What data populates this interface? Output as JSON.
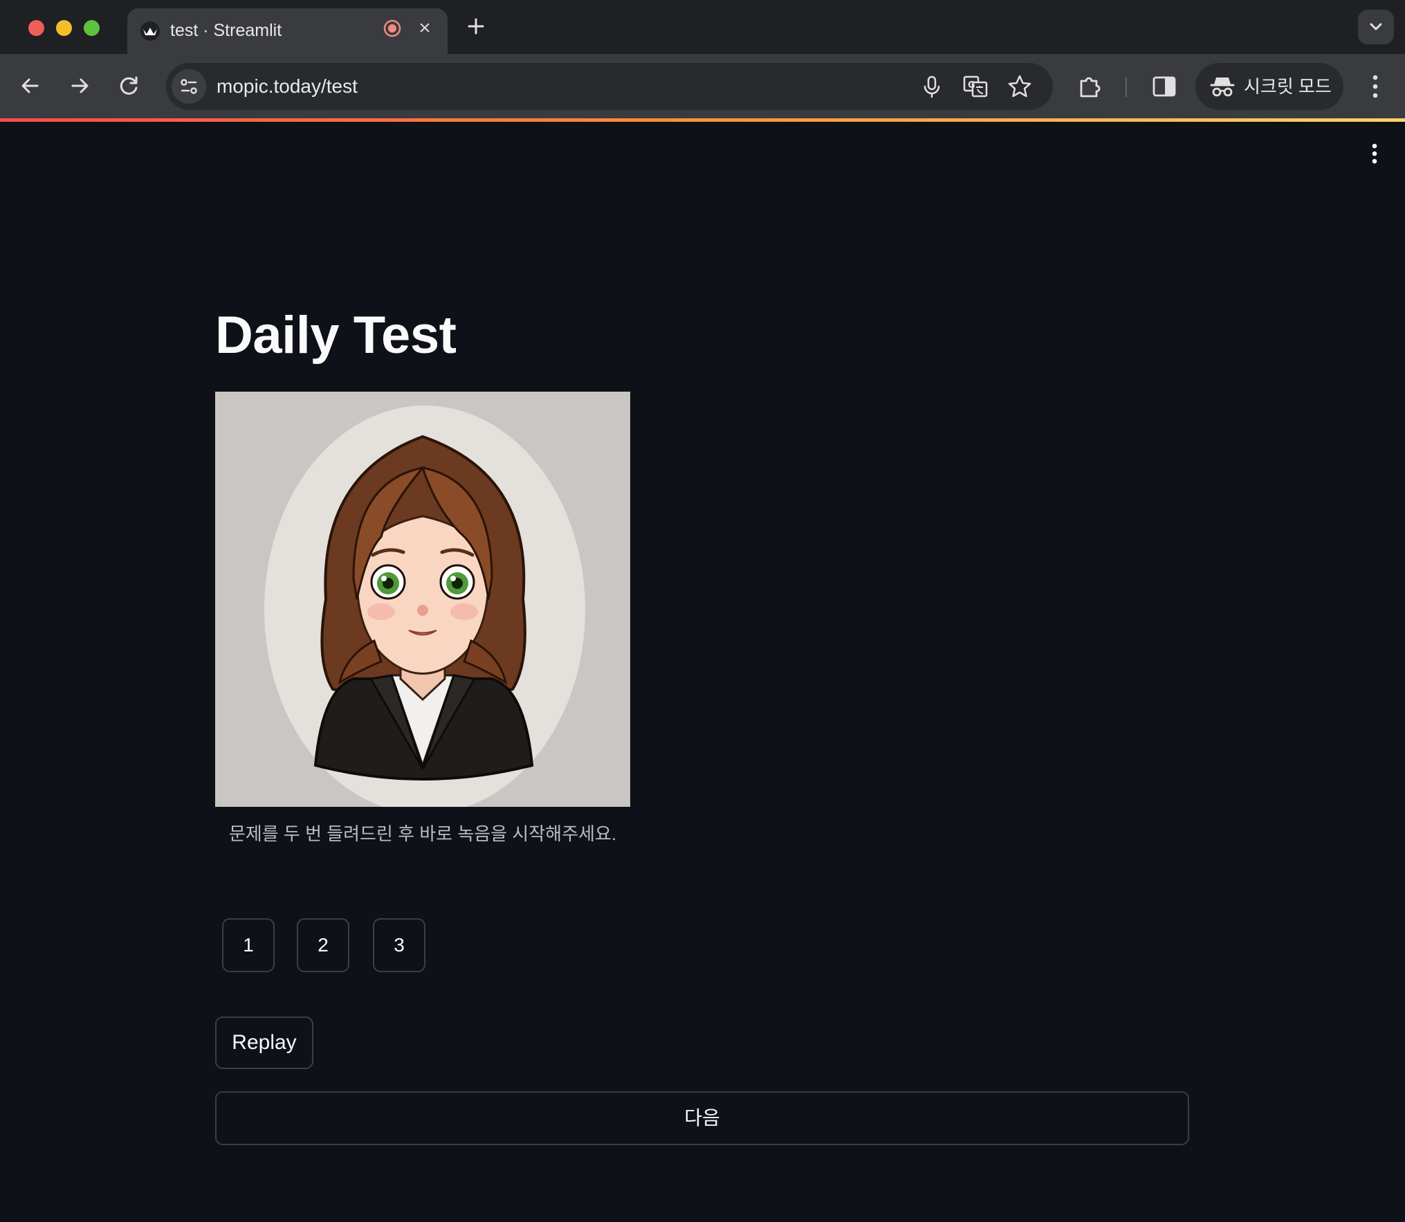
{
  "browser": {
    "tab": {
      "title": "test · Streamlit"
    },
    "address": {
      "url": "mopic.today/test"
    },
    "incognito_label": "시크릿 모드",
    "icons": [
      "streamlit-favicon",
      "recording-icon",
      "close-icon",
      "plus-icon",
      "chevron-down-icon",
      "back-arrow-icon",
      "forward-arrow-icon",
      "reload-icon",
      "site-settings-icon",
      "microphone-icon",
      "translate-icon",
      "star-icon",
      "extensions-icon",
      "side-panel-icon",
      "incognito-icon",
      "vertical-dots-icon"
    ]
  },
  "page": {
    "title": "Daily Test",
    "image_caption": "문제를 두 번 들려드린 후 바로 녹음을 시작해주세요.",
    "number_buttons": [
      "1",
      "2",
      "3"
    ],
    "replay_label": "Replay",
    "next_label": "다음"
  },
  "colors": {
    "app_background": "#0e1117",
    "text": "#fafafa",
    "button_border": "#3b3e46",
    "progress_gradient_start": "#ff4b4b",
    "progress_gradient_end": "#ffd36b"
  }
}
